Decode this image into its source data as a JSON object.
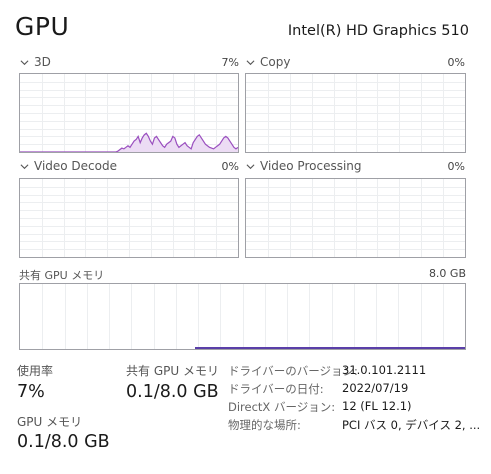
{
  "header": {
    "title": "GPU",
    "device": "Intel(R) HD Graphics 510"
  },
  "engines": [
    {
      "name": "3D",
      "pct": "7%"
    },
    {
      "name": "Copy",
      "pct": "0%"
    },
    {
      "name": "Video Decode",
      "pct": "0%"
    },
    {
      "name": "Video Processing",
      "pct": "0%"
    }
  ],
  "shared_memory_graph": {
    "label": "共有 GPU メモリ",
    "max": "8.0 GB"
  },
  "stats": {
    "usage": {
      "label": "使用率",
      "value": "7%"
    },
    "shared": {
      "label": "共有 GPU メモリ",
      "value": "0.1/8.0 GB"
    },
    "gpu_memory": {
      "label": "GPU メモリ",
      "value": "0.1/8.0 GB"
    }
  },
  "details": [
    {
      "label": "ドライバーのバージョン:",
      "value": "31.0.101.2111"
    },
    {
      "label": "ドライバーの日付:",
      "value": "2022/07/19"
    },
    {
      "label": "DirectX バージョン:",
      "value": "12 (FL 12.1)"
    },
    {
      "label": "物理的な場所:",
      "value": "PCI バス 0, デバイス 2, ..."
    }
  ],
  "colors": {
    "gpu_line": "#9a4fbf",
    "gpu_fill": "#ecdcf4",
    "grid": "#eceef0",
    "border": "#9fa0a6"
  }
}
